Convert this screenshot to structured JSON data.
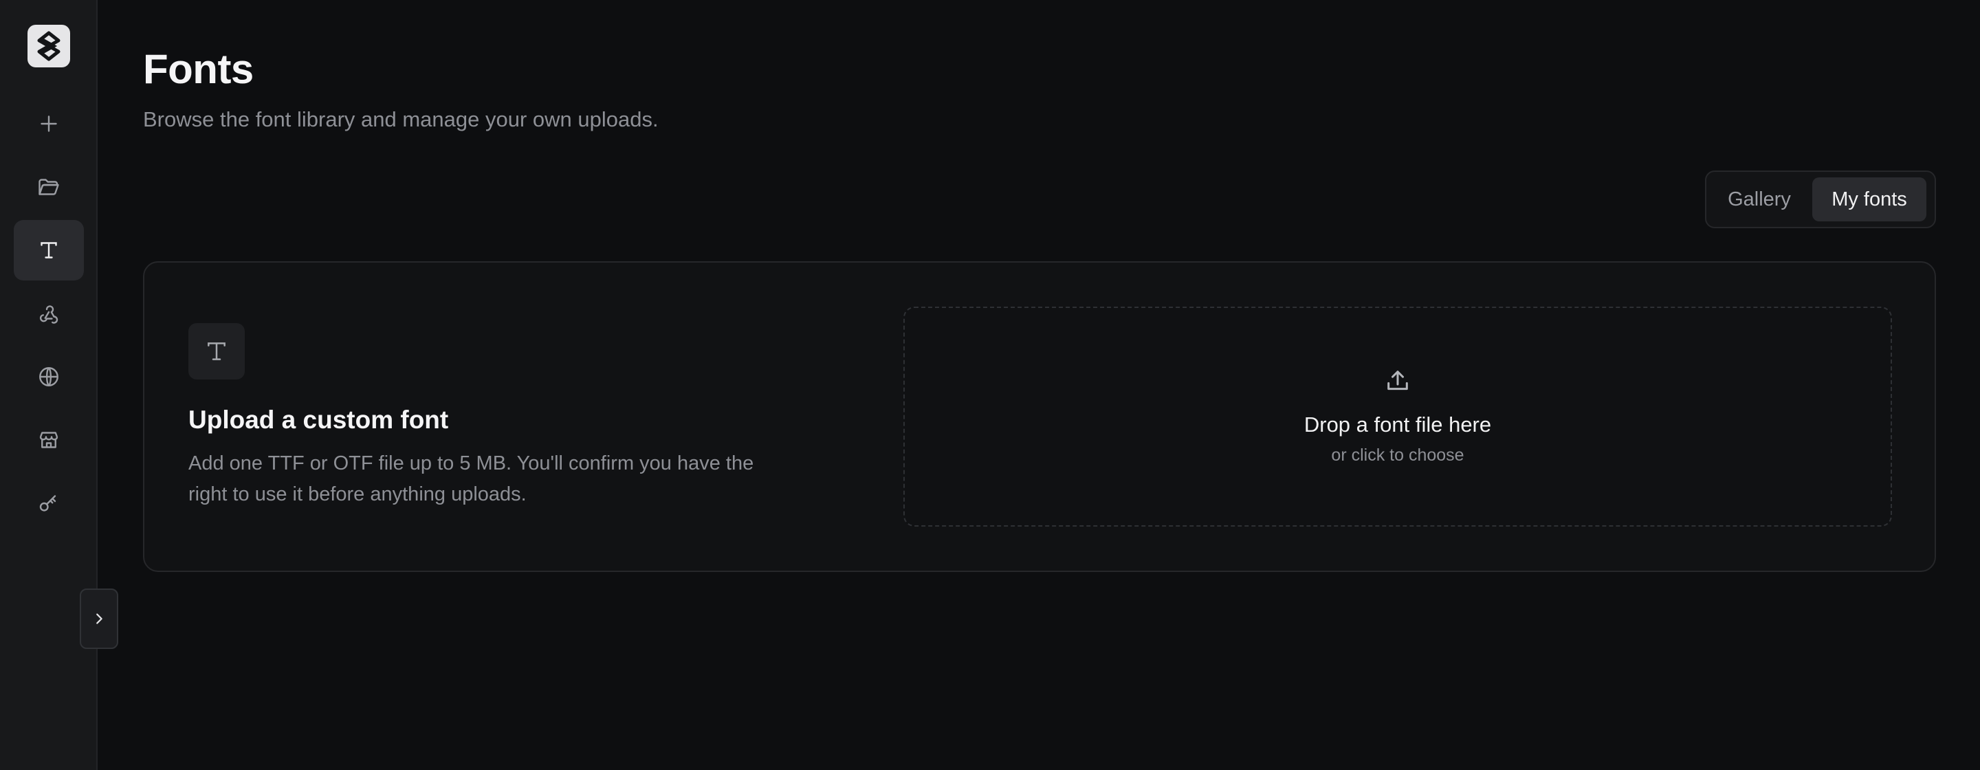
{
  "sidebar": {
    "logo_icon": "app-logo-icon",
    "items": [
      {
        "name": "plus-icon",
        "active": false
      },
      {
        "name": "folder-open-icon",
        "active": false
      },
      {
        "name": "type-icon",
        "active": true
      },
      {
        "name": "webhook-icon",
        "active": false
      },
      {
        "name": "globe-icon",
        "active": false
      },
      {
        "name": "store-icon",
        "active": false
      },
      {
        "name": "key-icon",
        "active": false
      }
    ],
    "collapse_icon": "chevron-right-icon"
  },
  "header": {
    "title": "Fonts",
    "subtitle": "Browse the font library and manage your own uploads."
  },
  "tabs": [
    {
      "label": "Gallery",
      "selected": false
    },
    {
      "label": "My fonts",
      "selected": true
    }
  ],
  "upload_card": {
    "icon": "type-icon",
    "title": "Upload a custom font",
    "description": "Add one TTF or OTF file up to 5 MB. You'll confirm you have the right to use it before anything uploads.",
    "dropzone": {
      "icon": "upload-icon",
      "title": "Drop a font file here",
      "subtitle": "or click to choose"
    }
  },
  "colors": {
    "background": "#0d0e10",
    "sidebar": "#18191b",
    "card": "#111214",
    "active": "#2a2b2f",
    "muted_text": "#8e9096"
  }
}
